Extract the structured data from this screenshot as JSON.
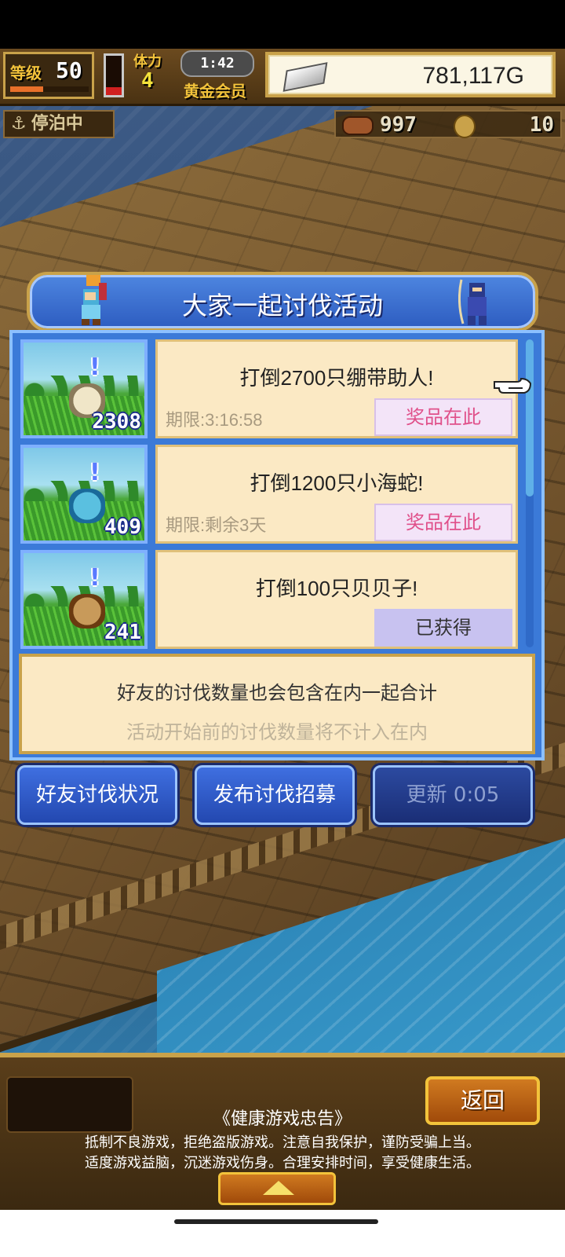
{
  "hud": {
    "level_label": "等级",
    "level_value": "50",
    "level_progress": 0.42,
    "stamina_label": "体力",
    "stamina_value": "4",
    "stamina_fill": 0.2,
    "timer": "1:42",
    "membership": "黄金会员",
    "money": "781,117G",
    "status": "停泊中",
    "resource1": "997",
    "resource2": "10"
  },
  "dialog": {
    "title": "大家一起讨伐活动",
    "missions": [
      {
        "count": "2308",
        "title": "打倒2700只绷带助人!",
        "deadline": "期限:3:16:58",
        "button": "奖品在此",
        "state": "prize",
        "monster": "mummy"
      },
      {
        "count": "409",
        "title": "打倒1200只小海蛇!",
        "deadline": "期限:剩余3天",
        "button": "奖品在此",
        "state": "prize",
        "monster": "sea-snake"
      },
      {
        "count": "241",
        "title": "打倒100只贝贝子!",
        "deadline": "",
        "button": "已获得",
        "state": "obtained",
        "monster": "shellfish"
      }
    ],
    "info_main": "好友的讨伐数量也会包含在内一起合计",
    "info_sub": "活动开始前的讨伐数量将不计入在内",
    "buttons": {
      "friends": "好友讨伐状况",
      "recruit": "发布讨伐招募",
      "refresh": "更新 0:05"
    }
  },
  "bottom": {
    "back": "返回",
    "advice_title": "《健康游戏忠告》",
    "advice_line1": "抵制不良游戏，拒绝盗版游戏。注意自我保护，谨防受骗上当。",
    "advice_line2": "适度游戏益脑，沉迷游戏伤身。合理安排时间，享受健康生活。"
  },
  "colors": {
    "prize_text": "#e0508a",
    "dialog_blue": "#3b7ad8",
    "card_bg": "#fbe9c4",
    "gold_border": "#c9a24a"
  }
}
